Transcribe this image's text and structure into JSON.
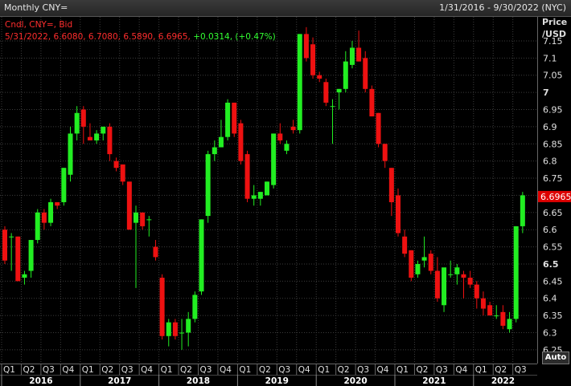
{
  "window": {
    "title": "Monthly CNY=",
    "date_range": "1/31/2016 - 9/30/2022 (NYC)"
  },
  "legend": {
    "line1": "Cndl, CNY=, Bid",
    "line2_values": "5/31/2022, 6.6080, 6.7080, 6.5890, 6.6965,",
    "line2_change": "+0.0314, (+0.47%)"
  },
  "axis": {
    "price_title": "Price",
    "unit_title": "/USD",
    "auto_label": "Auto",
    "last_price_label": "6.6965"
  },
  "colors": {
    "up": "#22ee22",
    "down": "#ee1111",
    "last_price_box": "#dd0000",
    "grid": "#3c3c3c",
    "background": "#000000"
  },
  "chart_data": {
    "type": "candlestick",
    "title": "Monthly CNY=",
    "ylabel": "Price /USD",
    "ylim": [
      6.21,
      7.22
    ],
    "yticks": [
      {
        "value": 7.15,
        "label": "7.15",
        "bold": false
      },
      {
        "value": 7.1,
        "label": "7.1",
        "bold": false
      },
      {
        "value": 7.05,
        "label": "7.05",
        "bold": false
      },
      {
        "value": 7.0,
        "label": "7",
        "bold": true
      },
      {
        "value": 6.95,
        "label": "6.95",
        "bold": false
      },
      {
        "value": 6.9,
        "label": "6.9",
        "bold": false
      },
      {
        "value": 6.85,
        "label": "6.85",
        "bold": false
      },
      {
        "value": 6.8,
        "label": "6.8",
        "bold": false
      },
      {
        "value": 6.75,
        "label": "6.75",
        "bold": false
      },
      {
        "value": 6.7,
        "label": "6.7",
        "bold": false
      },
      {
        "value": 6.65,
        "label": "6.65",
        "bold": false
      },
      {
        "value": 6.6,
        "label": "6.6",
        "bold": false
      },
      {
        "value": 6.55,
        "label": "6.55",
        "bold": false
      },
      {
        "value": 6.5,
        "label": "6.5",
        "bold": true
      },
      {
        "value": 6.45,
        "label": "6.45",
        "bold": false
      },
      {
        "value": 6.4,
        "label": "6.4",
        "bold": false
      },
      {
        "value": 6.35,
        "label": "6.35",
        "bold": false
      },
      {
        "value": 6.3,
        "label": "6.3",
        "bold": false
      },
      {
        "value": 6.25,
        "label": "6.25",
        "bold": false
      }
    ],
    "last_price": 6.6965,
    "quarters": [
      "Q1",
      "Q2",
      "Q3",
      "Q4",
      "Q1",
      "Q2",
      "Q3",
      "Q4",
      "Q1",
      "Q2",
      "Q3",
      "Q4",
      "Q1",
      "Q2",
      "Q3",
      "Q4",
      "Q1",
      "Q2",
      "Q3",
      "Q4",
      "Q1",
      "Q2",
      "Q3",
      "Q4",
      "Q1",
      "Q2",
      "Q3"
    ],
    "years": [
      "2016",
      "2017",
      "2018",
      "2019",
      "2020",
      "2021",
      "2022"
    ],
    "candles": [
      {
        "o": 6.6,
        "h": 6.61,
        "l": 6.5,
        "c": 6.51
      },
      {
        "o": 6.58,
        "h": 6.59,
        "l": 6.48,
        "c": 6.58
      },
      {
        "o": 6.58,
        "h": 6.58,
        "l": 6.45,
        "c": 6.45
      },
      {
        "o": 6.46,
        "h": 6.48,
        "l": 6.44,
        "c": 6.47
      },
      {
        "o": 6.48,
        "h": 6.57,
        "l": 6.46,
        "c": 6.57
      },
      {
        "o": 6.57,
        "h": 6.66,
        "l": 6.56,
        "c": 6.65
      },
      {
        "o": 6.65,
        "h": 6.66,
        "l": 6.6,
        "c": 6.62
      },
      {
        "o": 6.62,
        "h": 6.69,
        "l": 6.61,
        "c": 6.68
      },
      {
        "o": 6.68,
        "h": 6.68,
        "l": 6.66,
        "c": 6.67
      },
      {
        "o": 6.68,
        "h": 6.78,
        "l": 6.67,
        "c": 6.78
      },
      {
        "o": 6.76,
        "h": 6.9,
        "l": 6.74,
        "c": 6.88
      },
      {
        "o": 6.88,
        "h": 6.96,
        "l": 6.86,
        "c": 6.94
      },
      {
        "o": 6.95,
        "h": 6.96,
        "l": 6.85,
        "c": 6.9
      },
      {
        "o": 6.87,
        "h": 6.91,
        "l": 6.86,
        "c": 6.86
      },
      {
        "o": 6.86,
        "h": 6.89,
        "l": 6.85,
        "c": 6.88
      },
      {
        "o": 6.88,
        "h": 6.9,
        "l": 6.86,
        "c": 6.9
      },
      {
        "o": 6.9,
        "h": 6.91,
        "l": 6.8,
        "c": 6.82
      },
      {
        "o": 6.8,
        "h": 6.81,
        "l": 6.77,
        "c": 6.78
      },
      {
        "o": 6.79,
        "h": 6.79,
        "l": 6.73,
        "c": 6.74
      },
      {
        "o": 6.74,
        "h": 6.74,
        "l": 6.6,
        "c": 6.6
      },
      {
        "o": 6.62,
        "h": 6.67,
        "l": 6.43,
        "c": 6.65
      },
      {
        "o": 6.65,
        "h": 6.65,
        "l": 6.6,
        "c": 6.61
      },
      {
        "o": 6.63,
        "h": 6.64,
        "l": 6.58,
        "c": 6.63
      },
      {
        "o": 6.55,
        "h": 6.57,
        "l": 6.51,
        "c": 6.52
      },
      {
        "o": 6.46,
        "h": 6.47,
        "l": 6.28,
        "c": 6.29
      },
      {
        "o": 6.29,
        "h": 6.34,
        "l": 6.26,
        "c": 6.33
      },
      {
        "o": 6.33,
        "h": 6.34,
        "l": 6.28,
        "c": 6.29
      },
      {
        "o": 6.3,
        "h": 6.34,
        "l": 6.25,
        "c": 6.3
      },
      {
        "o": 6.3,
        "h": 6.36,
        "l": 6.26,
        "c": 6.34
      },
      {
        "o": 6.34,
        "h": 6.42,
        "l": 6.33,
        "c": 6.41
      },
      {
        "o": 6.42,
        "h": 6.63,
        "l": 6.41,
        "c": 6.63
      },
      {
        "o": 6.64,
        "h": 6.83,
        "l": 6.62,
        "c": 6.82
      },
      {
        "o": 6.82,
        "h": 6.86,
        "l": 6.8,
        "c": 6.84
      },
      {
        "o": 6.84,
        "h": 6.92,
        "l": 6.84,
        "c": 6.87
      },
      {
        "o": 6.87,
        "h": 6.98,
        "l": 6.86,
        "c": 6.97
      },
      {
        "o": 6.97,
        "h": 6.97,
        "l": 6.87,
        "c": 6.88
      },
      {
        "o": 6.91,
        "h": 6.92,
        "l": 6.79,
        "c": 6.8
      },
      {
        "o": 6.82,
        "h": 6.83,
        "l": 6.68,
        "c": 6.69
      },
      {
        "o": 6.69,
        "h": 6.73,
        "l": 6.67,
        "c": 6.7
      },
      {
        "o": 6.69,
        "h": 6.71,
        "l": 6.67,
        "c": 6.71
      },
      {
        "o": 6.7,
        "h": 6.74,
        "l": 6.7,
        "c": 6.74
      },
      {
        "o": 6.73,
        "h": 6.88,
        "l": 6.72,
        "c": 6.88
      },
      {
        "o": 6.88,
        "h": 6.91,
        "l": 6.85,
        "c": 6.86
      },
      {
        "o": 6.83,
        "h": 6.86,
        "l": 6.82,
        "c": 6.85
      },
      {
        "o": 6.9,
        "h": 6.92,
        "l": 6.88,
        "c": 6.89
      },
      {
        "o": 6.89,
        "h": 7.17,
        "l": 6.88,
        "c": 7.17
      },
      {
        "o": 7.17,
        "h": 7.19,
        "l": 7.09,
        "c": 7.1
      },
      {
        "o": 7.14,
        "h": 7.16,
        "l": 7.04,
        "c": 7.05
      },
      {
        "o": 7.05,
        "h": 7.06,
        "l": 7.03,
        "c": 7.04
      },
      {
        "o": 7.03,
        "h": 7.04,
        "l": 6.96,
        "c": 6.97
      },
      {
        "o": 6.96,
        "h": 6.98,
        "l": 6.85,
        "c": 6.96
      },
      {
        "o": 7.0,
        "h": 7.01,
        "l": 6.95,
        "c": 7.01
      },
      {
        "o": 7.01,
        "h": 7.12,
        "l": 7.0,
        "c": 7.09
      },
      {
        "o": 7.08,
        "h": 7.15,
        "l": 7.07,
        "c": 7.13
      },
      {
        "o": 7.13,
        "h": 7.18,
        "l": 7.09,
        "c": 7.09
      },
      {
        "o": 7.1,
        "h": 7.12,
        "l": 7.0,
        "c": 7.01
      },
      {
        "o": 7.01,
        "h": 7.02,
        "l": 6.93,
        "c": 6.93
      },
      {
        "o": 6.94,
        "h": 6.94,
        "l": 6.84,
        "c": 6.85
      },
      {
        "o": 6.85,
        "h": 6.85,
        "l": 6.78,
        "c": 6.8
      },
      {
        "o": 6.78,
        "h": 6.78,
        "l": 6.64,
        "c": 6.68
      },
      {
        "o": 6.7,
        "h": 6.72,
        "l": 6.58,
        "c": 6.59
      },
      {
        "o": 6.58,
        "h": 6.6,
        "l": 6.52,
        "c": 6.53
      },
      {
        "o": 6.54,
        "h": 6.54,
        "l": 6.45,
        "c": 6.46
      },
      {
        "o": 6.47,
        "h": 6.51,
        "l": 6.46,
        "c": 6.5
      },
      {
        "o": 6.51,
        "h": 6.58,
        "l": 6.49,
        "c": 6.52
      },
      {
        "o": 6.53,
        "h": 6.54,
        "l": 6.47,
        "c": 6.48
      },
      {
        "o": 6.48,
        "h": 6.52,
        "l": 6.39,
        "c": 6.4
      },
      {
        "o": 6.38,
        "h": 6.43,
        "l": 6.36,
        "c": 6.49
      },
      {
        "o": 6.47,
        "h": 6.51,
        "l": 6.46,
        "c": 6.47
      },
      {
        "o": 6.47,
        "h": 6.5,
        "l": 6.44,
        "c": 6.49
      },
      {
        "o": 6.47,
        "h": 6.48,
        "l": 6.4,
        "c": 6.46
      },
      {
        "o": 6.46,
        "h": 6.48,
        "l": 6.43,
        "c": 6.44
      },
      {
        "o": 6.44,
        "h": 6.45,
        "l": 6.37,
        "c": 6.4
      },
      {
        "o": 6.4,
        "h": 6.42,
        "l": 6.35,
        "c": 6.37
      },
      {
        "o": 6.38,
        "h": 6.39,
        "l": 6.35,
        "c": 6.35
      },
      {
        "o": 6.35,
        "h": 6.38,
        "l": 6.34,
        "c": 6.35
      },
      {
        "o": 6.36,
        "h": 6.38,
        "l": 6.31,
        "c": 6.32
      },
      {
        "o": 6.31,
        "h": 6.36,
        "l": 6.3,
        "c": 6.34
      },
      {
        "o": 6.34,
        "h": 6.61,
        "l": 6.33,
        "c": 6.61
      },
      {
        "o": 6.61,
        "h": 6.71,
        "l": 6.59,
        "c": 6.7
      }
    ]
  }
}
